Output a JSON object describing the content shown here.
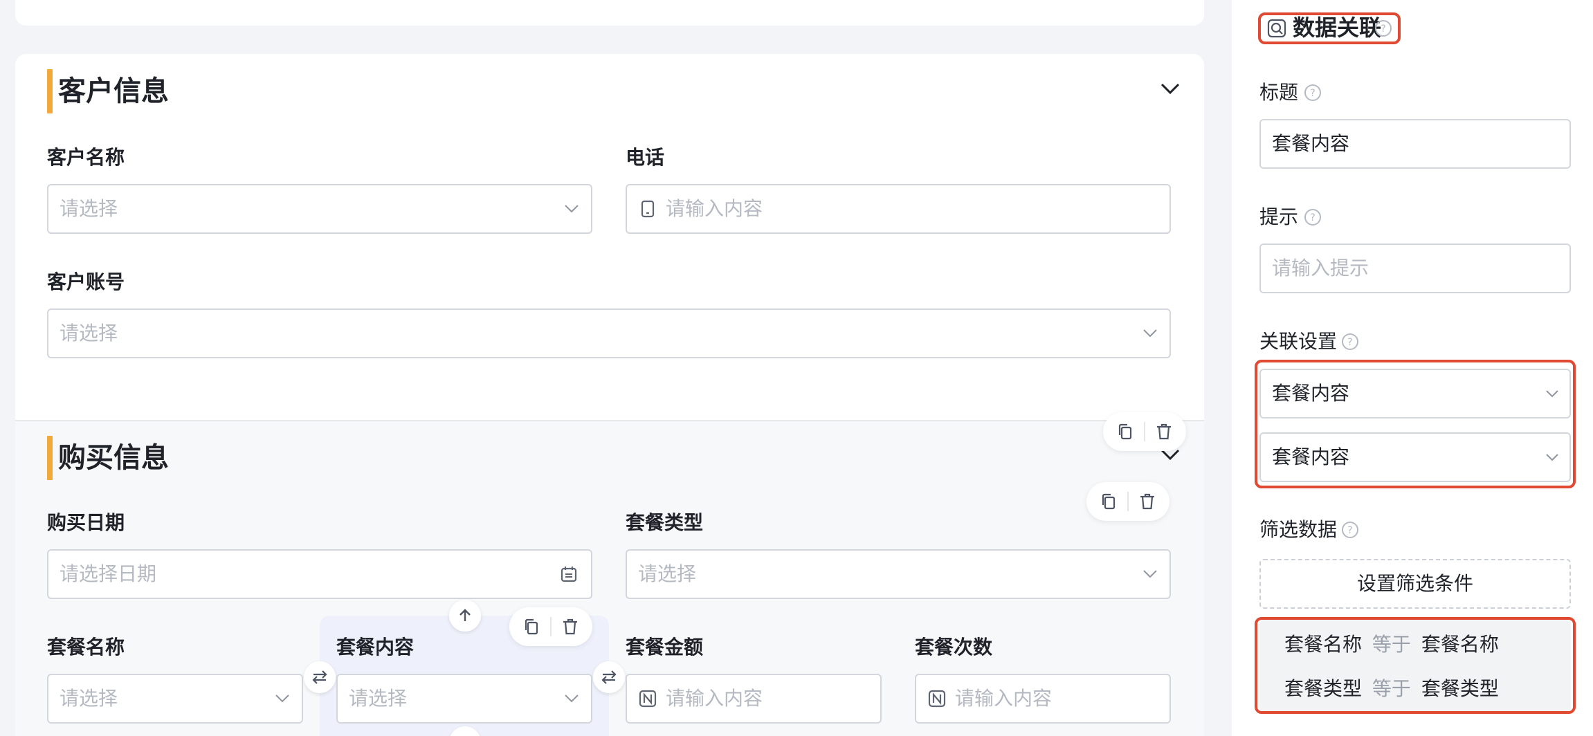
{
  "customer_section": {
    "title": "客户信息",
    "fields": {
      "customer_name": {
        "label": "客户名称",
        "placeholder": "请选择"
      },
      "phone": {
        "label": "电话",
        "placeholder": "请输入内容"
      },
      "customer_account": {
        "label": "客户账号",
        "placeholder": "请选择"
      }
    }
  },
  "purchase_section": {
    "title": "购买信息",
    "fields": {
      "purchase_date": {
        "label": "购买日期",
        "placeholder": "请选择日期"
      },
      "package_type": {
        "label": "套餐类型",
        "placeholder": "请选择"
      },
      "package_name": {
        "label": "套餐名称",
        "placeholder": "请选择"
      },
      "package_content": {
        "label": "套餐内容",
        "placeholder": "请选择"
      },
      "package_amount": {
        "label": "套餐金额",
        "placeholder": "请输入内容"
      },
      "package_count": {
        "label": "套餐次数",
        "placeholder": "请输入内容"
      }
    }
  },
  "panel": {
    "component_title": "数据关联",
    "title_label": "标题",
    "title_value": "套餐内容",
    "hint_label": "提示",
    "hint_placeholder": "请输入提示",
    "link_settings_label": "关联设置",
    "link_select_1": "套餐内容",
    "link_select_2": "套餐内容",
    "filter_label": "筛选数据",
    "filter_button": "设置筛选条件",
    "filters": [
      {
        "left": "套餐名称",
        "op": "等于",
        "right": "套餐名称"
      },
      {
        "left": "套餐类型",
        "op": "等于",
        "right": "套餐类型"
      }
    ]
  },
  "colors": {
    "section_accent": "#f3a93a",
    "highlight_border": "#e04a33",
    "selected_cell": "#eef1fb"
  }
}
